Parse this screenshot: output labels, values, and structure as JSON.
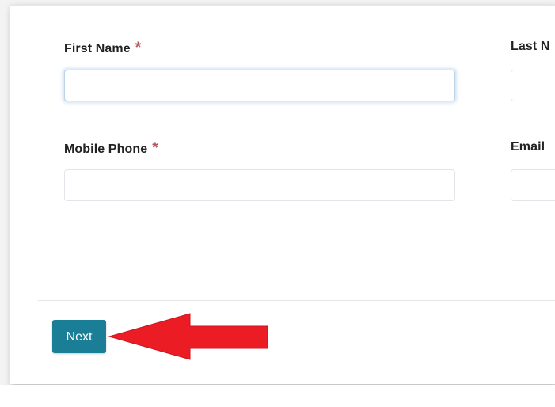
{
  "form": {
    "first_name": {
      "label": "First Name",
      "required_mark": "*",
      "value": ""
    },
    "last_name": {
      "label": "Last N",
      "value": ""
    },
    "mobile_phone": {
      "label": "Mobile Phone",
      "required_mark": "*",
      "value": ""
    },
    "email": {
      "label": "Email",
      "value": ""
    }
  },
  "actions": {
    "next_label": "Next"
  },
  "annotation": {
    "arrow_color": "#ec1c24",
    "arrow_icon": "red-left-arrow-icon"
  },
  "colors": {
    "button": "#197e96",
    "required": "#b5555b"
  }
}
